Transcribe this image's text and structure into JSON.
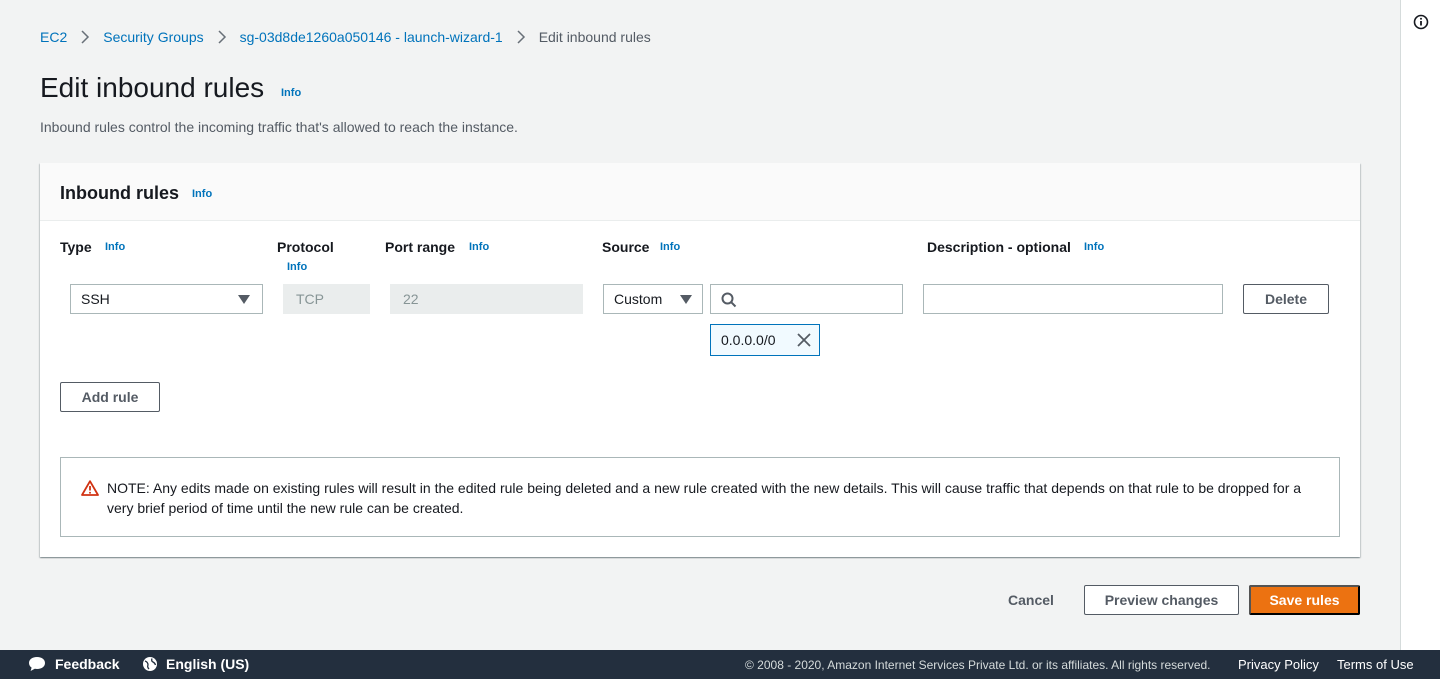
{
  "breadcrumb": {
    "items": [
      "EC2",
      "Security Groups",
      "sg-03d8de1260a050146 - launch-wizard-1"
    ],
    "current": "Edit inbound rules"
  },
  "page": {
    "title": "Edit inbound rules",
    "title_info": "Info",
    "description": "Inbound rules control the incoming traffic that's allowed to reach the instance."
  },
  "panel": {
    "title": "Inbound rules",
    "info": "Info",
    "columns": {
      "type": "Type",
      "protocol": "Protocol",
      "port_range": "Port range",
      "source": "Source",
      "description": "Description - optional",
      "info": "Info"
    },
    "rule": {
      "type": "SSH",
      "protocol": "TCP",
      "port_range": "22",
      "source_type": "Custom",
      "source_search": "",
      "source_token": "0.0.0.0/0",
      "description": "",
      "delete_label": "Delete"
    },
    "add_rule_label": "Add rule",
    "note": "NOTE: Any edits made on existing rules will result in the edited rule being deleted and a new rule created with the new details. This will cause traffic that depends on that rule to be dropped for a very brief period of time until the new rule can be created."
  },
  "actions": {
    "cancel": "Cancel",
    "preview": "Preview changes",
    "save": "Save rules"
  },
  "footer": {
    "feedback": "Feedback",
    "language": "English (US)",
    "copyright": "© 2008 - 2020, Amazon Internet Services Private Ltd. or its affiliates. All rights reserved.",
    "privacy": "Privacy Policy",
    "terms": "Terms of Use"
  },
  "colors": {
    "link": "#0073bb",
    "primary_button": "#ec7211",
    "footer_bg": "#232f3e",
    "warning": "#d13212"
  }
}
